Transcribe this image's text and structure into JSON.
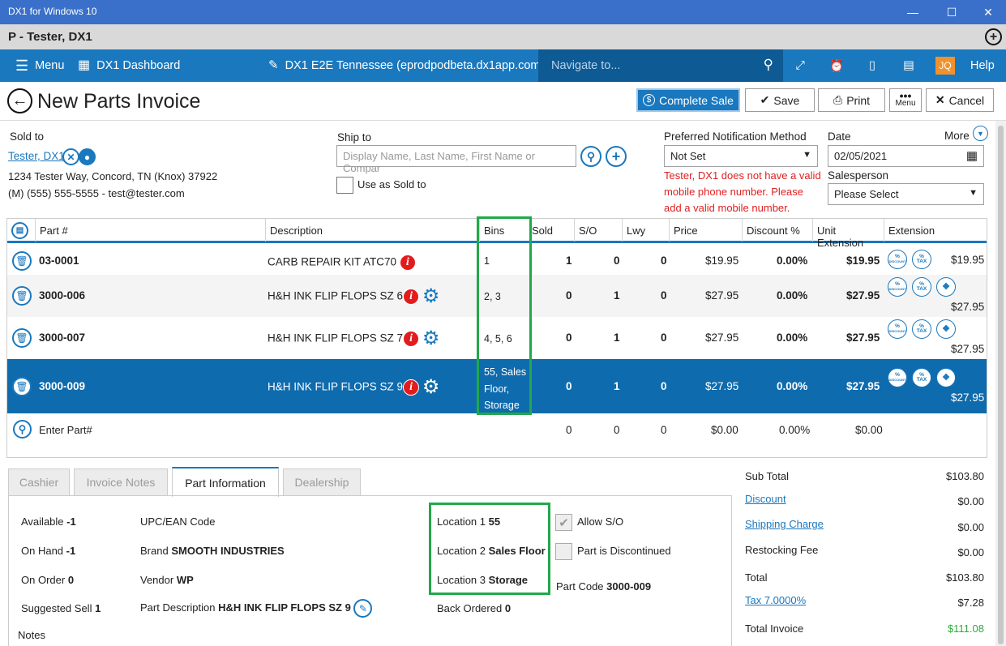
{
  "window": {
    "title": "DX1 for Windows 10",
    "customer_bar": "P - Tester, DX1"
  },
  "nav": {
    "menu": "Menu",
    "dashboard": "DX1 Dashboard",
    "store": "DX1 E2E Tennessee (eprodpodbeta.dx1app.com)",
    "search_placeholder": "Navigate to...",
    "user_initials": "JQ",
    "help": "Help"
  },
  "page": {
    "title": "New Parts Invoice"
  },
  "toolbar": {
    "complete_sale": "Complete Sale",
    "save": "Save",
    "print": "Print",
    "menu": "Menu",
    "cancel": "Cancel"
  },
  "sold_to": {
    "label": "Sold to",
    "name": "Tester, DX1",
    "address": "1234 Tester Way, Concord, TN (Knox) 37922",
    "contact": "(M) (555) 555-5555 - test@tester.com"
  },
  "ship_to": {
    "label": "Ship to",
    "placeholder": "Display Name, Last Name, First Name or Compar",
    "use_as_sold_to": "Use as Sold to"
  },
  "notification": {
    "label": "Preferred Notification Method",
    "value": "Not Set",
    "warning": [
      "Tester, DX1 does not have a valid",
      "mobile phone number. Please",
      "add a valid mobile number."
    ]
  },
  "date": {
    "label": "Date",
    "value": "02/05/2021",
    "more": "More"
  },
  "salesperson": {
    "label": "Salesperson",
    "value": "Please Select"
  },
  "grid": {
    "columns": [
      "Part #",
      "Description",
      "Bins",
      "Sold",
      "S/O",
      "Lwy",
      "Price",
      "Discount %",
      "Unit Extension",
      "Extension"
    ],
    "rows": [
      {
        "part": "03-0001",
        "description": "CARB REPAIR KIT ATC70",
        "bins": "1",
        "sold": "1",
        "so": "0",
        "lwy": "0",
        "price": "$19.95",
        "discount": "0.00%",
        "unit_ext": "$19.95",
        "ext": "$19.95"
      },
      {
        "part": "3000-006",
        "description": "H&H INK FLIP FLOPS SZ 6",
        "bins": "2, 3",
        "sold": "0",
        "so": "1",
        "lwy": "0",
        "price": "$27.95",
        "discount": "0.00%",
        "unit_ext": "$27.95",
        "ext": "$27.95"
      },
      {
        "part": "3000-007",
        "description": "H&H INK FLIP FLOPS SZ 7",
        "bins": "4, 5, 6",
        "sold": "0",
        "so": "1",
        "lwy": "0",
        "price": "$27.95",
        "discount": "0.00%",
        "unit_ext": "$27.95",
        "ext": "$27.95"
      },
      {
        "part": "3000-009",
        "description": "H&H INK FLIP FLOPS SZ 9",
        "bins": [
          "55, Sales",
          "Floor,",
          "Storage"
        ],
        "sold": "0",
        "so": "1",
        "lwy": "0",
        "price": "$27.95",
        "discount": "0.00%",
        "unit_ext": "$27.95",
        "ext": "$27.95"
      }
    ],
    "entry": {
      "label": "Enter Part#",
      "sold": "0",
      "so": "0",
      "lwy": "0",
      "price": "$0.00",
      "discount": "0.00%",
      "ext": "$0.00"
    },
    "badge_discount": "DISCOUNT",
    "badge_tax": "TAX",
    "badge_pct": "%"
  },
  "tabs": [
    "Cashier",
    "Invoice Notes",
    "Part Information",
    "Dealership"
  ],
  "part_info": {
    "available_label": "Available",
    "available": "-1",
    "on_hand_label": "On Hand",
    "on_hand": "-1",
    "on_order_label": "On Order",
    "on_order": "0",
    "suggested_label": "Suggested Sell",
    "suggested": "1",
    "upc_label": "UPC/EAN Code",
    "brand_label": "Brand",
    "brand": "SMOOTH INDUSTRIES",
    "vendor_label": "Vendor",
    "vendor": "WP",
    "part_desc_label": "Part Description",
    "part_desc": "H&H INK FLIP FLOPS SZ 9",
    "loc1_label": "Location 1",
    "loc1": "55",
    "loc2_label": "Location 2",
    "loc2": "Sales Floor",
    "loc3_label": "Location 3",
    "loc3": "Storage",
    "back_ordered_label": "Back Ordered",
    "back_ordered": "0",
    "allow_so": "Allow S/O",
    "discontinued": "Part is Discontinued",
    "part_code_label": "Part Code",
    "part_code": "3000-009",
    "notes_label": "Notes"
  },
  "totals": {
    "sub_total_label": "Sub Total",
    "sub_total": "$103.80",
    "discount_label": "Discount",
    "discount": "$0.00",
    "shipping_label": "Shipping Charge",
    "shipping": "$0.00",
    "restocking_label": "Restocking Fee",
    "restocking": "$0.00",
    "total_label": "Total",
    "total": "$103.80",
    "tax_label": "Tax 7.0000%",
    "tax": "$7.28",
    "total_invoice_label": "Total Invoice",
    "total_invoice": "$111.08"
  },
  "colors": {
    "brand_blue": "#1a78be",
    "selected_row": "#0e6bad",
    "highlight_box": "#22a84a",
    "warning": "#e02020",
    "total_invoice": "#2eaa3a"
  }
}
